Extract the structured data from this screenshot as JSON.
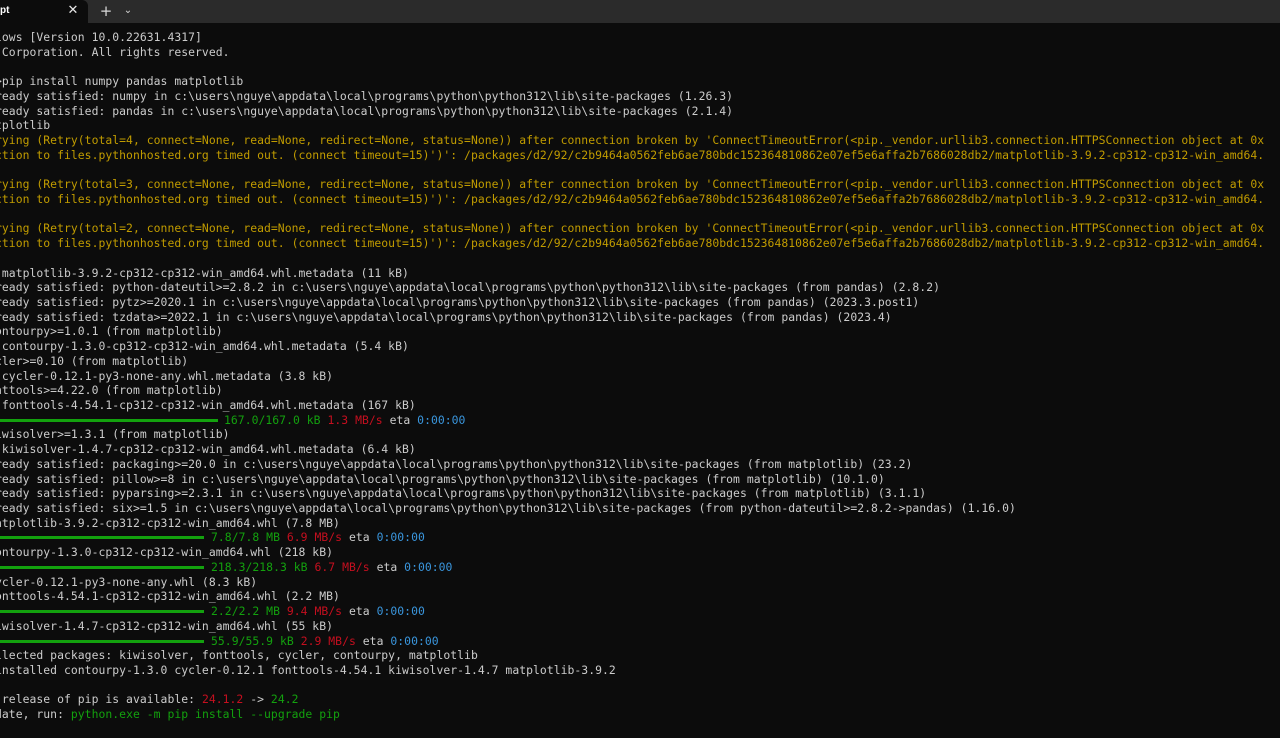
{
  "titlebar": {
    "tab_title": "pt",
    "close_glyph": "✕",
    "new_tab_glyph": "+",
    "dropdown_glyph": "⌄"
  },
  "terminal": {
    "lines": [
      {
        "text": "lows [Version 10.0.22631.4317]"
      },
      {
        "text": " Corporation. All rights reserved."
      },
      {
        "text": ""
      },
      {
        "text": ">pip install numpy pandas matplotlib"
      },
      {
        "text": "ready satisfied: numpy in c:\\users\\nguye\\appdata\\local\\programs\\python\\python312\\lib\\site-packages (1.26.3)"
      },
      {
        "text": "ready satisfied: pandas in c:\\users\\nguye\\appdata\\local\\programs\\python\\python312\\lib\\site-packages (2.1.4)"
      },
      {
        "text": "tplotlib"
      },
      {
        "text": "rying (Retry(total=4, connect=None, read=None, redirect=None, status=None)) after connection broken by 'ConnectTimeoutError(<pip._vendor.urllib3.connection.HTTPSConnection object at 0x",
        "color": "yellow"
      },
      {
        "text": "ction to files.pythonhosted.org timed out. (connect timeout=15)')': /packages/d2/92/c2b9464a0562feb6ae780bdc152364810862e07ef5e6affa2b7686028db2/matplotlib-3.9.2-cp312-cp312-win_amd64.",
        "color": "yellow"
      },
      {
        "text": ""
      },
      {
        "text": "rying (Retry(total=3, connect=None, read=None, redirect=None, status=None)) after connection broken by 'ConnectTimeoutError(<pip._vendor.urllib3.connection.HTTPSConnection object at 0x",
        "color": "yellow"
      },
      {
        "text": "ction to files.pythonhosted.org timed out. (connect timeout=15)')': /packages/d2/92/c2b9464a0562feb6ae780bdc152364810862e07ef5e6affa2b7686028db2/matplotlib-3.9.2-cp312-cp312-win_amd64.",
        "color": "yellow"
      },
      {
        "text": ""
      },
      {
        "text": "rying (Retry(total=2, connect=None, read=None, redirect=None, status=None)) after connection broken by 'ConnectTimeoutError(<pip._vendor.urllib3.connection.HTTPSConnection object at 0x",
        "color": "yellow"
      },
      {
        "text": "ction to files.pythonhosted.org timed out. (connect timeout=15)')': /packages/d2/92/c2b9464a0562feb6ae780bdc152364810862e07ef5e6affa2b7686028db2/matplotlib-3.9.2-cp312-cp312-win_amd64.",
        "color": "yellow"
      },
      {
        "text": ""
      },
      {
        "text": " matplotlib-3.9.2-cp312-cp312-win_amd64.whl.metadata (11 kB)"
      },
      {
        "text": "ready satisfied: python-dateutil>=2.8.2 in c:\\users\\nguye\\appdata\\local\\programs\\python\\python312\\lib\\site-packages (from pandas) (2.8.2)"
      },
      {
        "text": "ready satisfied: pytz>=2020.1 in c:\\users\\nguye\\appdata\\local\\programs\\python\\python312\\lib\\site-packages (from pandas) (2023.3.post1)"
      },
      {
        "text": "ready satisfied: tzdata>=2022.1 in c:\\users\\nguye\\appdata\\local\\programs\\python\\python312\\lib\\site-packages (from pandas) (2023.4)"
      },
      {
        "text": "ontourpy>=1.0.1 (from matplotlib)"
      },
      {
        "text": " contourpy-1.3.0-cp312-cp312-win_amd64.whl.metadata (5.4 kB)"
      },
      {
        "text": "cler>=0.10 (from matplotlib)"
      },
      {
        "text": " cycler-0.12.1-py3-none-any.whl.metadata (3.8 kB)"
      },
      {
        "text": "nttools>=4.22.0 (from matplotlib)"
      },
      {
        "text": " fonttools-4.54.1-cp312-cp312-win_amd64.whl.metadata (167 kB)"
      },
      {
        "progress": true,
        "done": "167.0/167.0 kB",
        "speed": "1.3 MB/s",
        "eta_label": "eta",
        "eta": "0:00:00"
      },
      {
        "text": "iwisolver>=1.3.1 (from matplotlib)"
      },
      {
        "text": " kiwisolver-1.4.7-cp312-cp312-win_amd64.whl.metadata (6.4 kB)"
      },
      {
        "text": "ready satisfied: packaging>=20.0 in c:\\users\\nguye\\appdata\\local\\programs\\python\\python312\\lib\\site-packages (from matplotlib) (23.2)"
      },
      {
        "text": "ready satisfied: pillow>=8 in c:\\users\\nguye\\appdata\\local\\programs\\python\\python312\\lib\\site-packages (from matplotlib) (10.1.0)"
      },
      {
        "text": "ready satisfied: pyparsing>=2.3.1 in c:\\users\\nguye\\appdata\\local\\programs\\python\\python312\\lib\\site-packages (from matplotlib) (3.1.1)"
      },
      {
        "text": "ready satisfied: six>=1.5 in c:\\users\\nguye\\appdata\\local\\programs\\python\\python312\\lib\\site-packages (from python-dateutil>=2.8.2->pandas) (1.16.0)"
      },
      {
        "text": "atplotlib-3.9.2-cp312-cp312-win_amd64.whl (7.8 MB)"
      },
      {
        "progress": true,
        "done": "7.8/7.8 MB",
        "speed": "6.9 MB/s",
        "eta_label": "eta",
        "eta": "0:00:00"
      },
      {
        "text": "ontourpy-1.3.0-cp312-cp312-win_amd64.whl (218 kB)"
      },
      {
        "progress": true,
        "done": "218.3/218.3 kB",
        "speed": "6.7 MB/s",
        "eta_label": "eta",
        "eta": "0:00:00"
      },
      {
        "text": "ycler-0.12.1-py3-none-any.whl (8.3 kB)"
      },
      {
        "text": "onttools-4.54.1-cp312-cp312-win_amd64.whl (2.2 MB)"
      },
      {
        "progress": true,
        "done": "2.2/2.2 MB",
        "speed": "9.4 MB/s",
        "eta_label": "eta",
        "eta": "0:00:00"
      },
      {
        "text": "iwisolver-1.4.7-cp312-cp312-win_amd64.whl (55 kB)"
      },
      {
        "progress": true,
        "done": "55.9/55.9 kB",
        "speed": "2.9 MB/s",
        "eta_label": "eta",
        "eta": "0:00:00"
      },
      {
        "text": "llected packages: kiwisolver, fonttools, cycler, contourpy, matplotlib"
      },
      {
        "text": "installed contourpy-1.3.0 cycler-0.12.1 fonttools-4.54.1 kiwisolver-1.4.7 matplotlib-3.9.2"
      },
      {
        "text": ""
      },
      {
        "segments": [
          {
            "text": " release of pip is available: "
          },
          {
            "text": "24.1.2",
            "color": "red"
          },
          {
            "text": " -> "
          },
          {
            "text": "24.2",
            "color": "green"
          }
        ]
      },
      {
        "segments": [
          {
            "text": "date, run: "
          },
          {
            "text": "python.exe -m pip install --upgrade pip",
            "color": "green"
          }
        ]
      }
    ]
  }
}
